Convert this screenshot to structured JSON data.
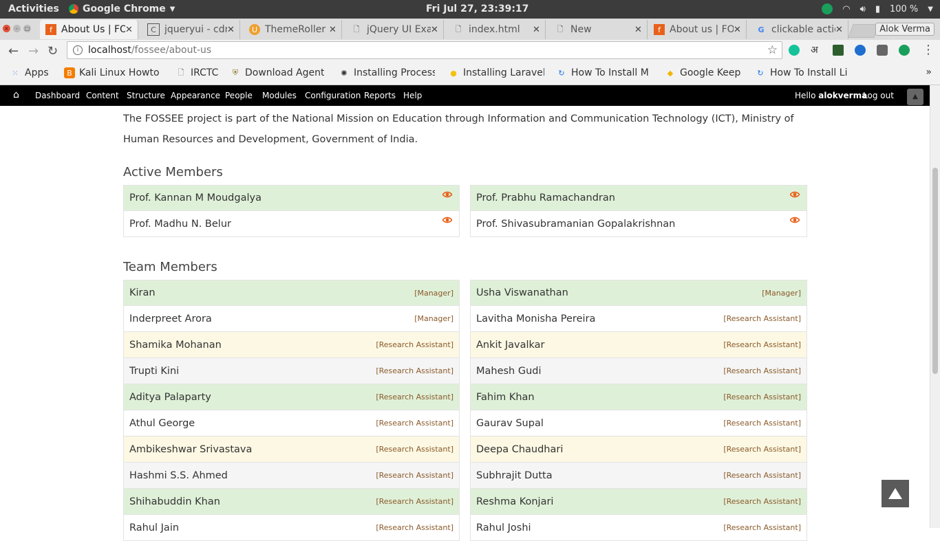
{
  "system": {
    "activities": "Activities",
    "app_name": "Google Chrome",
    "clock": "Fri Jul 27, 23:39:17",
    "battery": "100 %"
  },
  "browser": {
    "tabs": [
      {
        "title": "About Us | FOSSEE",
        "icon": "fossee-icon",
        "active": true
      },
      {
        "title": "jqueryui - cdn",
        "icon": "c-icon",
        "active": false
      },
      {
        "title": "ThemeRoller",
        "icon": "themeroller-icon",
        "active": false
      },
      {
        "title": "jQuery UI Example",
        "icon": "page-icon",
        "active": false
      },
      {
        "title": "index.html",
        "icon": "page-icon",
        "active": false
      },
      {
        "title": "New",
        "icon": "page-icon",
        "active": false
      },
      {
        "title": "About us | FOSSEE",
        "icon": "fossee-icon",
        "active": false
      },
      {
        "title": "clickable action",
        "icon": "google-icon",
        "active": false
      }
    ],
    "profile": "Alok Verma",
    "url_host": "localhost",
    "url_path": "/fossee/about-us",
    "bookmarks": [
      {
        "label": "Apps",
        "icon": "apps-grid-icon"
      },
      {
        "label": "Kali Linux Howto",
        "icon": "blogger-icon"
      },
      {
        "label": "IRCTC",
        "icon": "page-icon"
      },
      {
        "label": "Download Agent",
        "icon": "shield-icon"
      },
      {
        "label": "Installing Process",
        "icon": "gear-icon"
      },
      {
        "label": "Installing Laravel",
        "icon": "bulb-icon"
      },
      {
        "label": "How To Install M",
        "icon": "refresh-icon"
      },
      {
        "label": "Google Keep",
        "icon": "keep-icon"
      },
      {
        "label": "How To Install Li",
        "icon": "refresh-icon"
      }
    ]
  },
  "admin_bar": {
    "menu": [
      "Dashboard",
      "Content",
      "Structure",
      "Appearance",
      "People",
      "Modules",
      "Configuration",
      "Reports",
      "Help"
    ],
    "hello": "Hello",
    "username": "alokverma",
    "logout": "Log out"
  },
  "page": {
    "intro": "The FOSSEE project is part of the National Mission on Education through Information and Communication Technology (ICT), Ministry of Human Resources and Development, Government of India.",
    "active_heading": "Active Members",
    "active_members": [
      [
        "Prof. Kannan M Moudgalya",
        "Prof. Prabhu Ramachandran"
      ],
      [
        "Prof. Madhu N. Belur",
        "Prof. Shivasubramanian Gopalakrishnan"
      ]
    ],
    "team_heading": "Team Members",
    "team_members": [
      [
        {
          "name": "Kiran",
          "role": "[Manager]"
        },
        {
          "name": "Usha Viswanathan",
          "role": "[Manager]"
        }
      ],
      [
        {
          "name": "Inderpreet Arora",
          "role": "[Manager]"
        },
        {
          "name": "Lavitha Monisha Pereira",
          "role": "[Research Assistant]"
        }
      ],
      [
        {
          "name": "Shamika Mohanan",
          "role": "[Research Assistant]"
        },
        {
          "name": "Ankit Javalkar",
          "role": "[Research Assistant]"
        }
      ],
      [
        {
          "name": "Trupti Kini",
          "role": "[Research Assistant]"
        },
        {
          "name": "Mahesh Gudi",
          "role": "[Research Assistant]"
        }
      ],
      [
        {
          "name": "Aditya Palaparty",
          "role": "[Research Assistant]"
        },
        {
          "name": "Fahim Khan",
          "role": "[Research Assistant]"
        }
      ],
      [
        {
          "name": "Athul George",
          "role": "[Research Assistant]"
        },
        {
          "name": "Gaurav Supal",
          "role": "[Research Assistant]"
        }
      ],
      [
        {
          "name": "Ambikeshwar Srivastava",
          "role": "[Research Assistant]"
        },
        {
          "name": "Deepa Chaudhari",
          "role": "[Research Assistant]"
        }
      ],
      [
        {
          "name": "Hashmi S.S. Ahmed",
          "role": "[Research Assistant]"
        },
        {
          "name": "Subhrajit Dutta",
          "role": "[Research Assistant]"
        }
      ],
      [
        {
          "name": "Shihabuddin Khan",
          "role": "[Research Assistant]"
        },
        {
          "name": "Reshma Konjari",
          "role": "[Research Assistant]"
        }
      ],
      [
        {
          "name": "Rahul Jain",
          "role": "[Research Assistant]"
        },
        {
          "name": "Rahul Joshi",
          "role": "[Research Assistant]"
        }
      ]
    ]
  },
  "colors": {
    "green_row": "#dff0d8",
    "cream_row": "#fcf8e3",
    "grey_row": "#f5f5f5",
    "eye_icon": "#e8611a",
    "role_text": "#8a5a2b"
  }
}
